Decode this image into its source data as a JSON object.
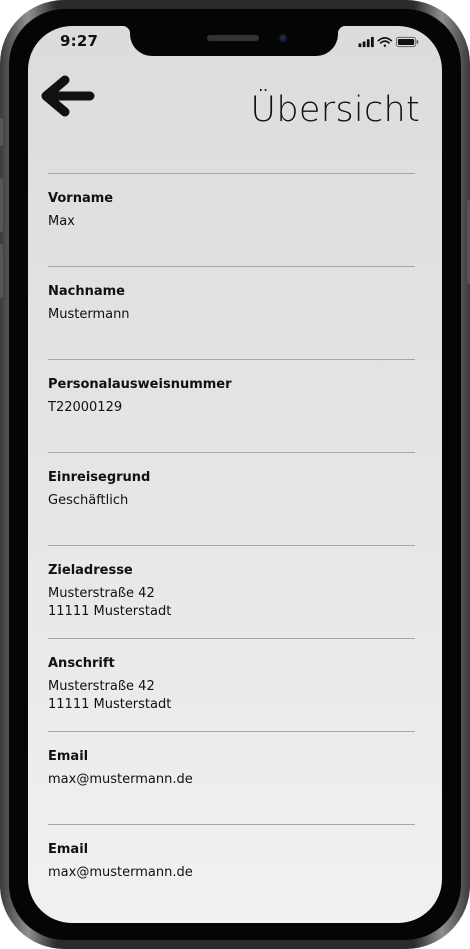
{
  "status_bar": {
    "time": "9:27"
  },
  "header": {
    "title": "Übersicht"
  },
  "fields": [
    {
      "label": "Vorname",
      "lines": [
        "Max"
      ]
    },
    {
      "label": "Nachname",
      "lines": [
        "Mustermann"
      ]
    },
    {
      "label": "Personalausweisnummer",
      "lines": [
        "T22000129"
      ]
    },
    {
      "label": "Einreisegrund",
      "lines": [
        "Geschäftlich"
      ]
    },
    {
      "label": "Zieladresse",
      "lines": [
        "Musterstraße 42",
        "11111 Musterstadt"
      ]
    },
    {
      "label": "Anschrift",
      "lines": [
        "Musterstraße 42",
        "11111 Musterstadt"
      ]
    },
    {
      "label": "Email",
      "lines": [
        "max@mustermann.de"
      ]
    },
    {
      "label": "Email",
      "lines": [
        "max@mustermann.de"
      ]
    }
  ],
  "icons": {
    "back": "arrow-left-icon",
    "signal": "cellular-signal-icon",
    "wifi": "wifi-icon",
    "battery": "battery-icon"
  }
}
